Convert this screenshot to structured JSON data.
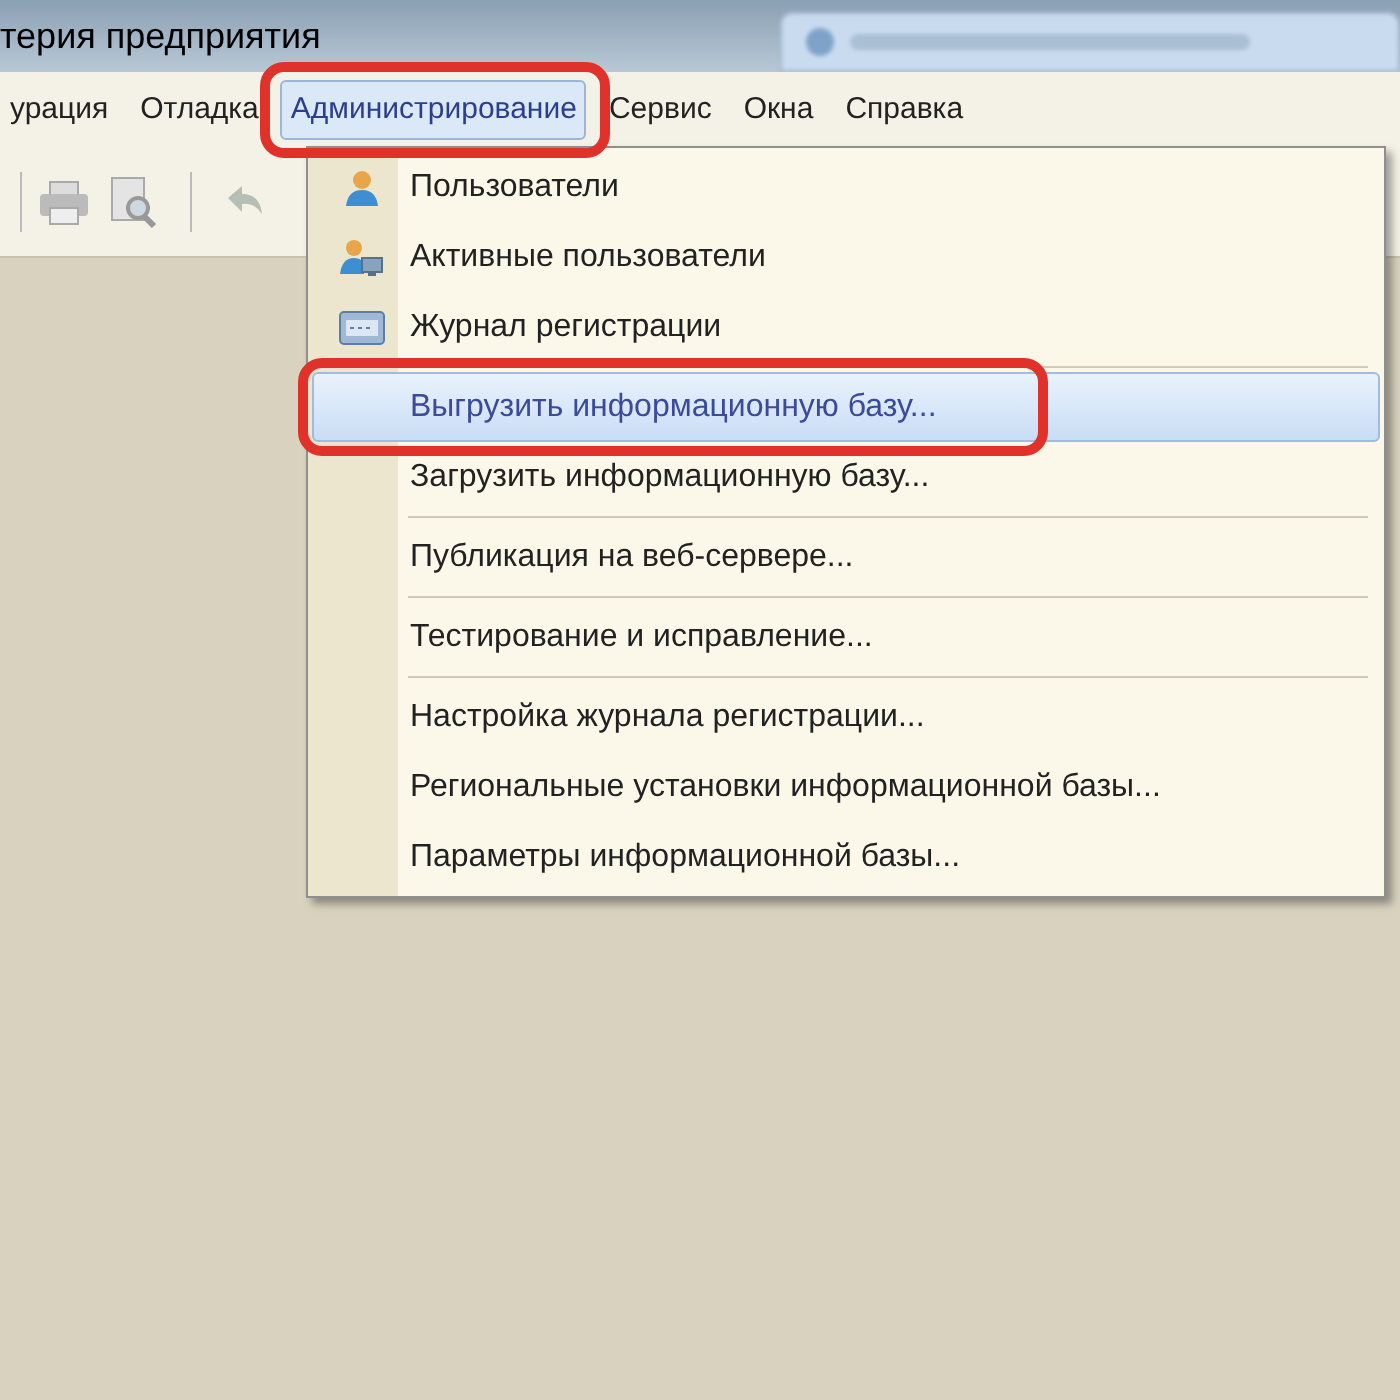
{
  "window": {
    "title": "терия предприятия"
  },
  "menu_bar": [
    {
      "label": "урация",
      "selected": false,
      "highlighted": false
    },
    {
      "label": "Отладка",
      "selected": false,
      "highlighted": false
    },
    {
      "label": "Администрирование",
      "selected": true,
      "highlighted": true
    },
    {
      "label": "Сервис",
      "selected": false,
      "highlighted": false
    },
    {
      "label": "Окна",
      "selected": false,
      "highlighted": false
    },
    {
      "label": "Справка",
      "selected": false,
      "highlighted": false
    }
  ],
  "menu": {
    "items": [
      {
        "kind": "item",
        "label": "Пользователи",
        "selected": false,
        "highlighted": false
      },
      {
        "kind": "item",
        "label": "Активные пользователи",
        "selected": false,
        "highlighted": false
      },
      {
        "kind": "item",
        "label": "Журнал регистрации",
        "selected": false,
        "highlighted": false
      },
      {
        "kind": "separator"
      },
      {
        "kind": "item",
        "label": "Выгрузить информационную базу...",
        "selected": true,
        "highlighted": true
      },
      {
        "kind": "item",
        "label": "Загрузить информационную базу...",
        "selected": false,
        "highlighted": false
      },
      {
        "kind": "separator"
      },
      {
        "kind": "item",
        "label": "Публикация на веб-сервере...",
        "selected": false,
        "highlighted": false
      },
      {
        "kind": "separator"
      },
      {
        "kind": "item",
        "label": "Тестирование и исправление...",
        "selected": false,
        "highlighted": false
      },
      {
        "kind": "separator"
      },
      {
        "kind": "item",
        "label": "Настройка журнала регистрации...",
        "selected": false,
        "highlighted": false
      },
      {
        "kind": "item",
        "label": "Региональные установки информационной базы...",
        "selected": false,
        "highlighted": false
      },
      {
        "kind": "item",
        "label": "Параметры информационной базы...",
        "selected": false,
        "highlighted": false
      }
    ]
  }
}
